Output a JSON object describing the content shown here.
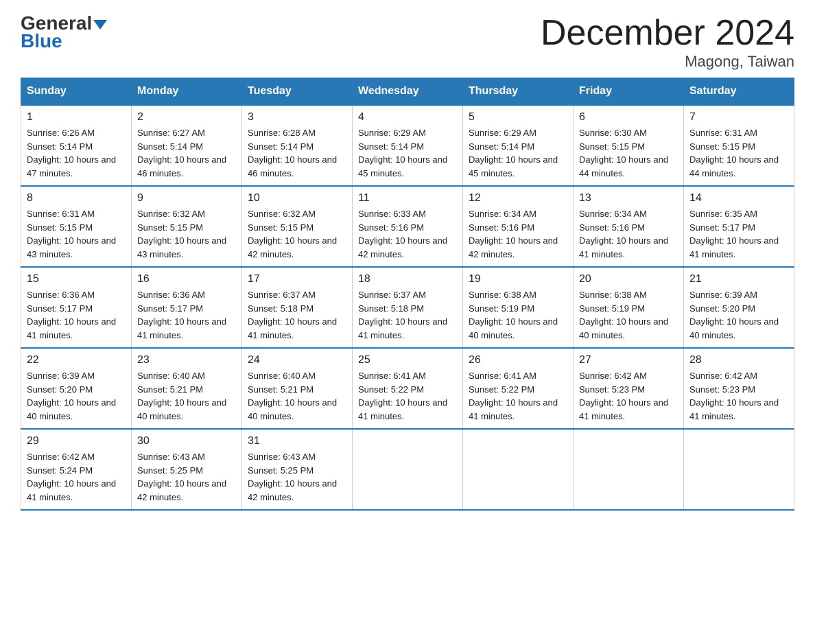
{
  "logo": {
    "part1": "General",
    "part2": "Blue"
  },
  "title": "December 2024",
  "subtitle": "Magong, Taiwan",
  "days_of_week": [
    "Sunday",
    "Monday",
    "Tuesday",
    "Wednesday",
    "Thursday",
    "Friday",
    "Saturday"
  ],
  "weeks": [
    [
      {
        "day": "1",
        "sunrise": "6:26 AM",
        "sunset": "5:14 PM",
        "daylight": "10 hours and 47 minutes."
      },
      {
        "day": "2",
        "sunrise": "6:27 AM",
        "sunset": "5:14 PM",
        "daylight": "10 hours and 46 minutes."
      },
      {
        "day": "3",
        "sunrise": "6:28 AM",
        "sunset": "5:14 PM",
        "daylight": "10 hours and 46 minutes."
      },
      {
        "day": "4",
        "sunrise": "6:29 AM",
        "sunset": "5:14 PM",
        "daylight": "10 hours and 45 minutes."
      },
      {
        "day": "5",
        "sunrise": "6:29 AM",
        "sunset": "5:14 PM",
        "daylight": "10 hours and 45 minutes."
      },
      {
        "day": "6",
        "sunrise": "6:30 AM",
        "sunset": "5:15 PM",
        "daylight": "10 hours and 44 minutes."
      },
      {
        "day": "7",
        "sunrise": "6:31 AM",
        "sunset": "5:15 PM",
        "daylight": "10 hours and 44 minutes."
      }
    ],
    [
      {
        "day": "8",
        "sunrise": "6:31 AM",
        "sunset": "5:15 PM",
        "daylight": "10 hours and 43 minutes."
      },
      {
        "day": "9",
        "sunrise": "6:32 AM",
        "sunset": "5:15 PM",
        "daylight": "10 hours and 43 minutes."
      },
      {
        "day": "10",
        "sunrise": "6:32 AM",
        "sunset": "5:15 PM",
        "daylight": "10 hours and 42 minutes."
      },
      {
        "day": "11",
        "sunrise": "6:33 AM",
        "sunset": "5:16 PM",
        "daylight": "10 hours and 42 minutes."
      },
      {
        "day": "12",
        "sunrise": "6:34 AM",
        "sunset": "5:16 PM",
        "daylight": "10 hours and 42 minutes."
      },
      {
        "day": "13",
        "sunrise": "6:34 AM",
        "sunset": "5:16 PM",
        "daylight": "10 hours and 41 minutes."
      },
      {
        "day": "14",
        "sunrise": "6:35 AM",
        "sunset": "5:17 PM",
        "daylight": "10 hours and 41 minutes."
      }
    ],
    [
      {
        "day": "15",
        "sunrise": "6:36 AM",
        "sunset": "5:17 PM",
        "daylight": "10 hours and 41 minutes."
      },
      {
        "day": "16",
        "sunrise": "6:36 AM",
        "sunset": "5:17 PM",
        "daylight": "10 hours and 41 minutes."
      },
      {
        "day": "17",
        "sunrise": "6:37 AM",
        "sunset": "5:18 PM",
        "daylight": "10 hours and 41 minutes."
      },
      {
        "day": "18",
        "sunrise": "6:37 AM",
        "sunset": "5:18 PM",
        "daylight": "10 hours and 41 minutes."
      },
      {
        "day": "19",
        "sunrise": "6:38 AM",
        "sunset": "5:19 PM",
        "daylight": "10 hours and 40 minutes."
      },
      {
        "day": "20",
        "sunrise": "6:38 AM",
        "sunset": "5:19 PM",
        "daylight": "10 hours and 40 minutes."
      },
      {
        "day": "21",
        "sunrise": "6:39 AM",
        "sunset": "5:20 PM",
        "daylight": "10 hours and 40 minutes."
      }
    ],
    [
      {
        "day": "22",
        "sunrise": "6:39 AM",
        "sunset": "5:20 PM",
        "daylight": "10 hours and 40 minutes."
      },
      {
        "day": "23",
        "sunrise": "6:40 AM",
        "sunset": "5:21 PM",
        "daylight": "10 hours and 40 minutes."
      },
      {
        "day": "24",
        "sunrise": "6:40 AM",
        "sunset": "5:21 PM",
        "daylight": "10 hours and 40 minutes."
      },
      {
        "day": "25",
        "sunrise": "6:41 AM",
        "sunset": "5:22 PM",
        "daylight": "10 hours and 41 minutes."
      },
      {
        "day": "26",
        "sunrise": "6:41 AM",
        "sunset": "5:22 PM",
        "daylight": "10 hours and 41 minutes."
      },
      {
        "day": "27",
        "sunrise": "6:42 AM",
        "sunset": "5:23 PM",
        "daylight": "10 hours and 41 minutes."
      },
      {
        "day": "28",
        "sunrise": "6:42 AM",
        "sunset": "5:23 PM",
        "daylight": "10 hours and 41 minutes."
      }
    ],
    [
      {
        "day": "29",
        "sunrise": "6:42 AM",
        "sunset": "5:24 PM",
        "daylight": "10 hours and 41 minutes."
      },
      {
        "day": "30",
        "sunrise": "6:43 AM",
        "sunset": "5:25 PM",
        "daylight": "10 hours and 42 minutes."
      },
      {
        "day": "31",
        "sunrise": "6:43 AM",
        "sunset": "5:25 PM",
        "daylight": "10 hours and 42 minutes."
      },
      null,
      null,
      null,
      null
    ]
  ]
}
